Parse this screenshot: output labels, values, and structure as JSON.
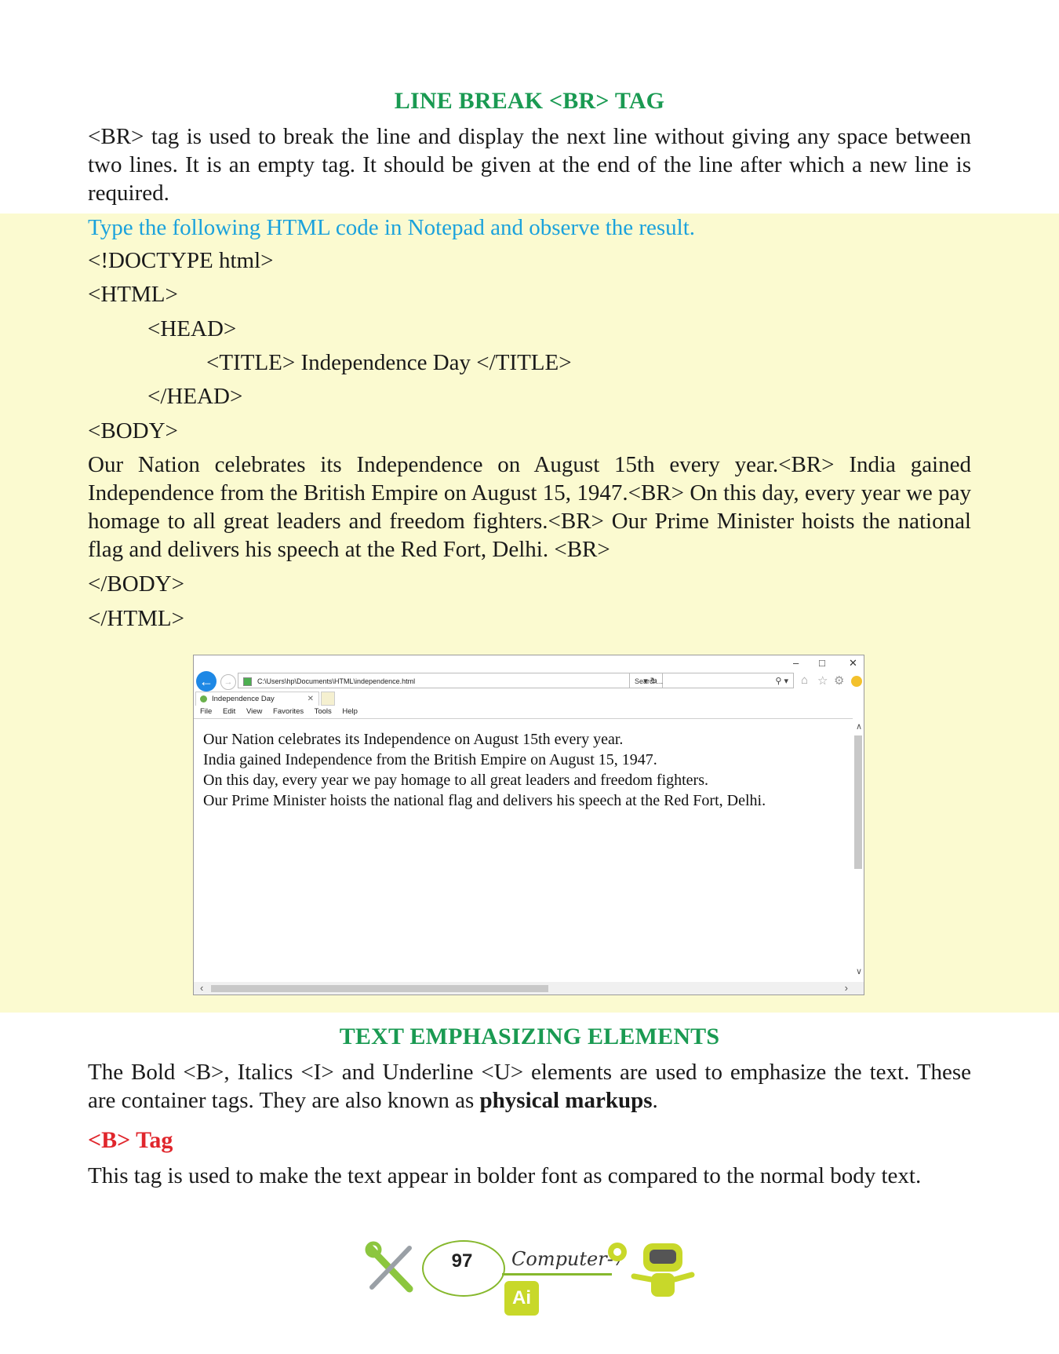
{
  "section1": {
    "heading": "LINE BREAK <BR> TAG",
    "paragraph": "<BR> tag is used to break the line and display the next line without giving any space between two lines. It is an empty tag. It should be given at the end of the line after which a new line is required."
  },
  "code_block": {
    "instruction": "Type the following HTML code in Notepad and observe the result.",
    "lines": {
      "doctype": "<!DOCTYPE html>",
      "html_open": "<HTML>",
      "head_open": "<HEAD>",
      "title": "<TITLE> Independence Day </TITLE>",
      "head_close": "</HEAD>",
      "body_open": "<BODY>",
      "body_text": "Our Nation celebrates its Independence on August 15th every year.<BR> India gained Independence from the British Empire on August 15, 1947.<BR> On this day, every year we pay homage to all great leaders and freedom fighters.<BR> Our Prime Minister hoists the national flag and delivers his speech at the Red Fort, Delhi. <BR>",
      "body_close": "</BODY>",
      "html_close": "</HTML>"
    }
  },
  "browser": {
    "address": "C:\\Users\\hp\\Documents\\HTML\\independence.html",
    "search_placeholder": "Search...",
    "tab_title": "Independence Day",
    "menu": [
      "File",
      "Edit",
      "View",
      "Favorites",
      "Tools",
      "Help"
    ],
    "output_lines": [
      "Our Nation celebrates its Independence on August 15th every year.",
      "India gained Independence from the British Empire on August 15, 1947.",
      "On this day, every year we pay homage to all great leaders and freedom fighters.",
      "Our Prime Minister hoists the national flag and delivers his speech at the Red Fort, Delhi."
    ]
  },
  "section2": {
    "heading": "TEXT EMPHASIZING ELEMENTS",
    "paragraph_start": "The Bold <B>, Italics <I> and Underline <U> elements are used to emphasize the text. These are container tags. They are also known as ",
    "paragraph_bold": "physical markups",
    "paragraph_end": "."
  },
  "b_tag": {
    "heading": "<B> Tag",
    "paragraph": "This tag is used to make the text appear in bolder font as compared to the normal body text."
  },
  "footer": {
    "page_number": "97",
    "brand": "Computer-7",
    "badge": "Ai"
  }
}
